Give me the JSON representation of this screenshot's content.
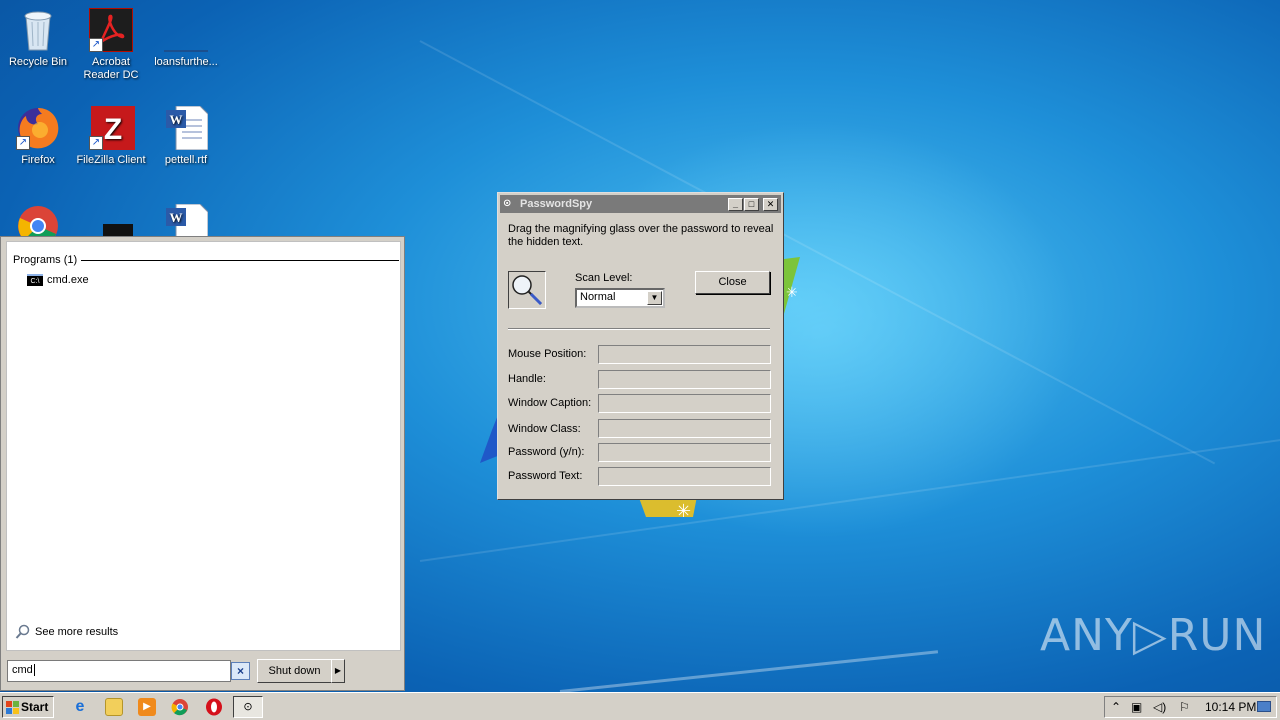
{
  "desktop": {
    "icons": [
      {
        "label": "Recycle Bin"
      },
      {
        "label": "Acrobat Reader DC"
      },
      {
        "label": "loansfurthe..."
      },
      {
        "label": "Firefox"
      },
      {
        "label": "FileZilla Client"
      },
      {
        "label": "pettell.rtf"
      }
    ]
  },
  "start_menu": {
    "section_header": "Programs (1)",
    "program_item": "cmd.exe",
    "see_more": "See more results",
    "search_value": "cmd",
    "shutdown_label": "Shut down"
  },
  "password_spy": {
    "title": "PasswordSpy",
    "description": "Drag the magnifying glass over the password to reveal the hidden text.",
    "scan_level_label": "Scan Level:",
    "scan_level_value": "Normal",
    "close_label": "Close",
    "fields": [
      {
        "label": "Mouse Position:",
        "value": ""
      },
      {
        "label": "Handle:",
        "value": ""
      },
      {
        "label": "Window Caption:",
        "value": ""
      },
      {
        "label": "Window Class:",
        "value": ""
      },
      {
        "label": "Password (y/n):",
        "value": ""
      },
      {
        "label": "Password Text:",
        "value": ""
      }
    ]
  },
  "taskbar": {
    "start_label": "Start",
    "clock": "10:14 PM",
    "pinned": [
      "internet-explorer-icon",
      "explorer-icon",
      "media-player-icon",
      "chrome-icon",
      "opera-icon"
    ]
  },
  "watermark": "ANY▷RUN"
}
